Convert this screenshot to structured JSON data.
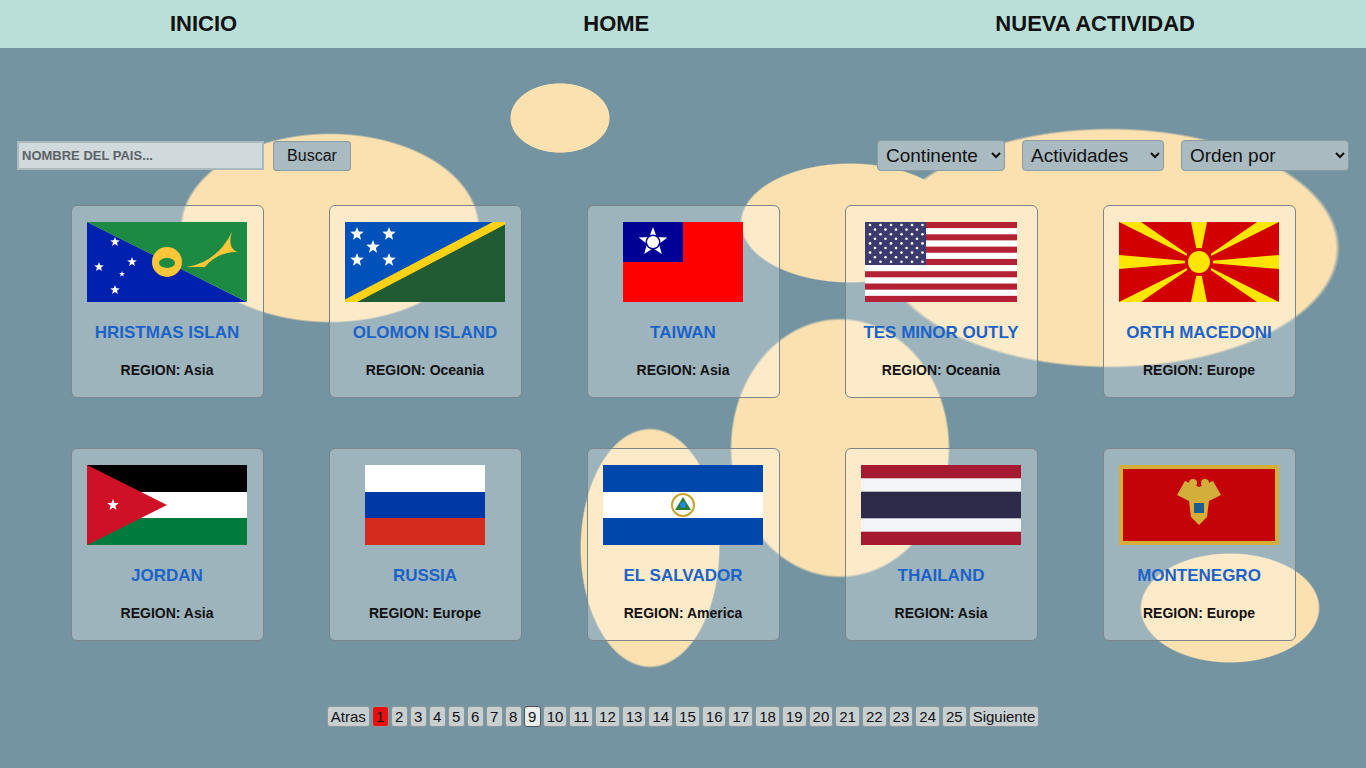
{
  "nav": [
    {
      "label": "INICIO"
    },
    {
      "label": "HOME"
    },
    {
      "label": "NUEVA ACTIVIDAD"
    }
  ],
  "search": {
    "placeholder": "NOMBRE DEL PAIS...",
    "button": "Buscar"
  },
  "filters": [
    {
      "label": "Continente"
    },
    {
      "label": "Actividades"
    },
    {
      "label": "Orden por"
    }
  ],
  "regionLabel": "REGION:",
  "countries": [
    {
      "name": "HRISTMAS ISLAN",
      "region": "Asia",
      "kind": "christmas-island"
    },
    {
      "name": "OLOMON ISLAND",
      "region": "Oceania",
      "kind": "solomon-islands"
    },
    {
      "name": "TAIWAN",
      "region": "Asia",
      "kind": "taiwan"
    },
    {
      "name": "TES MINOR OUTLY",
      "region": "Oceania",
      "kind": "usa"
    },
    {
      "name": "ORTH MACEDONI",
      "region": "Europe",
      "kind": "north-macedonia"
    },
    {
      "name": "JORDAN",
      "region": "Asia",
      "kind": "jordan"
    },
    {
      "name": "RUSSIA",
      "region": "Europe",
      "kind": "russia"
    },
    {
      "name": "EL SALVADOR",
      "region": "America",
      "kind": "el-salvador"
    },
    {
      "name": "THAILAND",
      "region": "Asia",
      "kind": "thailand"
    },
    {
      "name": "MONTENEGRO",
      "region": "Europe",
      "kind": "montenegro"
    }
  ],
  "pagination": {
    "prev": "Atras",
    "next": "Siguiente",
    "pages": [
      {
        "label": "1",
        "selected": true,
        "highlighted": false
      },
      {
        "label": "2",
        "selected": false,
        "highlighted": false
      },
      {
        "label": "3",
        "selected": false,
        "highlighted": false
      },
      {
        "label": "4",
        "selected": false,
        "highlighted": false
      },
      {
        "label": "5",
        "selected": false,
        "highlighted": false
      },
      {
        "label": "6",
        "selected": false,
        "highlighted": false
      },
      {
        "label": "7",
        "selected": false,
        "highlighted": false
      },
      {
        "label": "8",
        "selected": false,
        "highlighted": false
      },
      {
        "label": "9",
        "selected": false,
        "highlighted": true
      },
      {
        "label": "10",
        "selected": false,
        "highlighted": false
      },
      {
        "label": "11",
        "selected": false,
        "highlighted": false
      },
      {
        "label": "12",
        "selected": false,
        "highlighted": false
      },
      {
        "label": "13",
        "selected": false,
        "highlighted": false
      },
      {
        "label": "14",
        "selected": false,
        "highlighted": false
      },
      {
        "label": "15",
        "selected": false,
        "highlighted": false
      },
      {
        "label": "16",
        "selected": false,
        "highlighted": false
      },
      {
        "label": "17",
        "selected": false,
        "highlighted": false
      },
      {
        "label": "18",
        "selected": false,
        "highlighted": false
      },
      {
        "label": "19",
        "selected": false,
        "highlighted": false
      },
      {
        "label": "20",
        "selected": false,
        "highlighted": false
      },
      {
        "label": "21",
        "selected": false,
        "highlighted": false
      },
      {
        "label": "22",
        "selected": false,
        "highlighted": false
      },
      {
        "label": "23",
        "selected": false,
        "highlighted": false
      },
      {
        "label": "24",
        "selected": false,
        "highlighted": false
      },
      {
        "label": "25",
        "selected": false,
        "highlighted": false
      }
    ]
  }
}
